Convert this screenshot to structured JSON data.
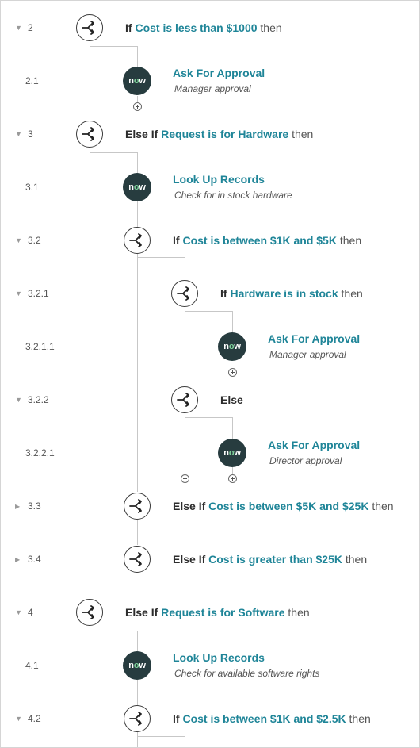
{
  "steps": {
    "s2": {
      "num": "2",
      "kw": "If",
      "cond": "Cost is less than $1000",
      "tail": "then"
    },
    "s2_1": {
      "num": "2.1",
      "title": "Ask For Approval",
      "desc": "Manager approval"
    },
    "s3": {
      "num": "3",
      "kw": "Else If",
      "cond": "Request is for Hardware",
      "tail": "then"
    },
    "s3_1": {
      "num": "3.1",
      "title": "Look Up Records",
      "desc": "Check for in stock hardware"
    },
    "s3_2": {
      "num": "3.2",
      "kw": "If",
      "cond": "Cost is between $1K and $5K",
      "tail": "then"
    },
    "s3_2_1": {
      "num": "3.2.1",
      "kw": "If",
      "cond": "Hardware is in stock",
      "tail": "then"
    },
    "s3_2_1_1": {
      "num": "3.2.1.1",
      "title": "Ask For Approval",
      "desc": "Manager approval"
    },
    "s3_2_2": {
      "num": "3.2.2",
      "kw": "Else"
    },
    "s3_2_2_1": {
      "num": "3.2.2.1",
      "title": "Ask For Approval",
      "desc": "Director approval"
    },
    "s3_3": {
      "num": "3.3",
      "kw": "Else If",
      "cond": "Cost is between $5K and $25K",
      "tail": "then"
    },
    "s3_4": {
      "num": "3.4",
      "kw": "Else If",
      "cond": "Cost is greater than $25K",
      "tail": "then"
    },
    "s4": {
      "num": "4",
      "kw": "Else If",
      "cond": "Request is for Software",
      "tail": "then"
    },
    "s4_1": {
      "num": "4.1",
      "title": "Look Up Records",
      "desc": "Check for available software rights"
    },
    "s4_2": {
      "num": "4.2",
      "kw": "If",
      "cond": "Cost is between $1K and $2.5K",
      "tail": "then"
    }
  },
  "logo": {
    "n": "n",
    "o": "o",
    "w": "w"
  },
  "icons": {
    "flow": "flow-logic-branch-icon",
    "action": "servicenow-logo",
    "add": "add-step-icon",
    "expanded": "caret-down-icon",
    "collapsed": "caret-right-icon"
  },
  "colors": {
    "link": "#1f8598",
    "node_dark": "#273c3f",
    "logo_accent": "#7ed09a"
  }
}
